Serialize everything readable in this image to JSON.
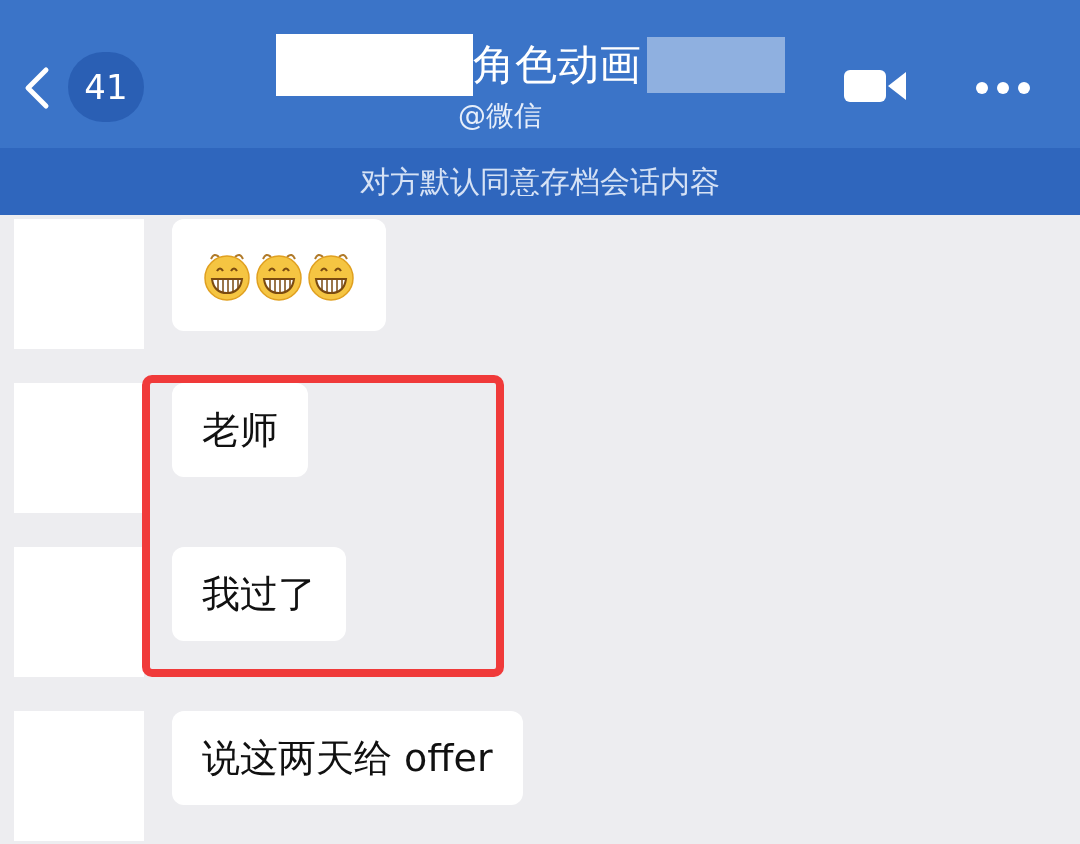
{
  "header": {
    "back_count": "41",
    "title": "角色动画",
    "subtitle": "@微信"
  },
  "notice": "对方默认同意存档会话内容",
  "messages": [
    {
      "kind": "emoji",
      "emojis": [
        {
          "kind": "grin"
        },
        {
          "kind": "grin"
        },
        {
          "kind": "grin"
        }
      ],
      "highlighted": false
    },
    {
      "kind": "text",
      "text": "老师",
      "highlighted": true
    },
    {
      "kind": "text",
      "text": "我过了",
      "highlighted": true
    },
    {
      "kind": "text",
      "text": "说这两天给 offer",
      "highlighted": false
    }
  ]
}
